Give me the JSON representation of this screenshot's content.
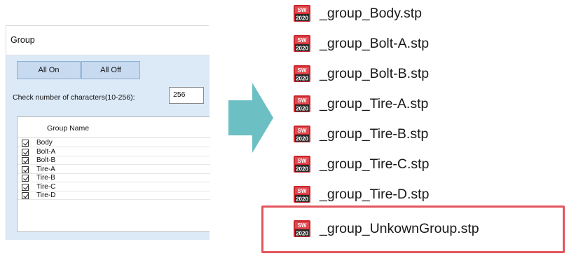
{
  "dialog": {
    "title": "Group",
    "all_on_label": "All On",
    "all_off_label": "All Off",
    "char_check_label": "Check number of characters(10-256):",
    "char_check_value": "256",
    "column_header": "Group Name",
    "rows": [
      {
        "name": "Body",
        "checked": true
      },
      {
        "name": "Bolt-A",
        "checked": true
      },
      {
        "name": "Bolt-B",
        "checked": true
      },
      {
        "name": "Tire-A",
        "checked": true
      },
      {
        "name": "Tire-B",
        "checked": true
      },
      {
        "name": "Tire-C",
        "checked": true
      },
      {
        "name": "Tire-D",
        "checked": true
      }
    ]
  },
  "arrow": {
    "color": "#6cbfc3",
    "icon": "right-arrow-icon"
  },
  "files": {
    "icon": "sw2020-file-icon",
    "icon_text_top": "SW",
    "icon_text_bottom": "2020",
    "icon_color": "#c9262c",
    "items": [
      "_group_Body.stp",
      "_group_Bolt-A.stp",
      "_group_Bolt-B.stp",
      "_group_Tire-A.stp",
      "_group_Tire-B.stp",
      "_group_Tire-C.stp",
      "_group_Tire-D.stp",
      "_group_UnkownGroup.stp"
    ],
    "highlight_color": "#e2575e",
    "highlighted_item": "_group_UnkownGroup.stp"
  }
}
